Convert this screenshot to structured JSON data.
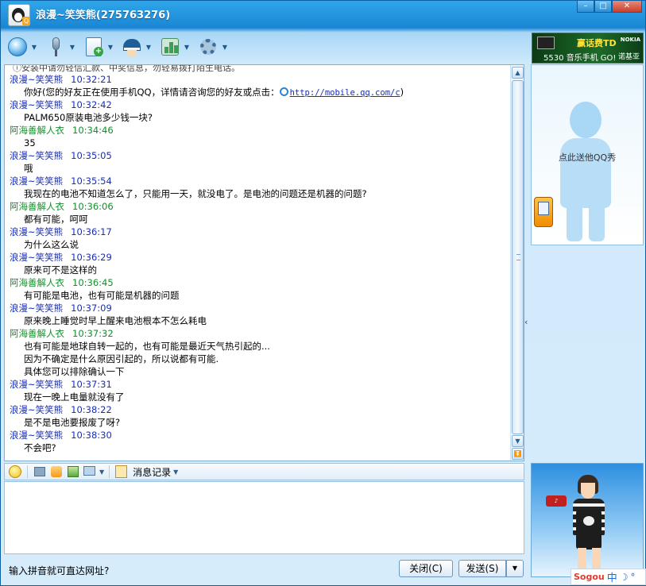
{
  "window": {
    "title": "浪漫~笑笑熊(275763276)",
    "controls": [
      "–",
      "□",
      "✕"
    ]
  },
  "toolbar": {
    "items": [
      {
        "name": "video-chat",
        "icon": "video-sphere-icon"
      },
      {
        "name": "voice-chat",
        "icon": "microphone-icon"
      },
      {
        "name": "send-file",
        "icon": "document-add-icon"
      },
      {
        "name": "friend-info",
        "icon": "police-cap-icon"
      },
      {
        "name": "apps",
        "icon": "app-bars-icon"
      },
      {
        "name": "settings",
        "icon": "gear-icon"
      }
    ]
  },
  "history": {
    "system_line": "ⓘ安装中请勿轻信汇款、中奖信息，勿轻易拨打陌生电话。",
    "messages": [
      {
        "sender": "浪漫~笑笑熊",
        "role": "me",
        "time": "10:32:21",
        "lines": [
          "你好(您的好友正在使用手机QQ，详情请咨询您的好友或点击：)"
        ],
        "link": "http://mobile.qq.com/c"
      },
      {
        "sender": "浪漫~笑笑熊",
        "role": "me",
        "time": "10:32:42",
        "lines": [
          "PALM650原装电池多少钱一块?"
        ]
      },
      {
        "sender": "阿海善解人衣",
        "role": "peer",
        "time": "10:34:46",
        "lines": [
          "35"
        ]
      },
      {
        "sender": "浪漫~笑笑熊",
        "role": "me",
        "time": "10:35:05",
        "lines": [
          "哦"
        ]
      },
      {
        "sender": "浪漫~笑笑熊",
        "role": "me",
        "time": "10:35:54",
        "lines": [
          "我现在的电池不知道怎么了，只能用一天，就没电了。是电池的问题还是机器的问题?"
        ]
      },
      {
        "sender": "阿海善解人衣",
        "role": "peer",
        "time": "10:36:06",
        "lines": [
          "都有可能，呵呵"
        ]
      },
      {
        "sender": "浪漫~笑笑熊",
        "role": "me",
        "time": "10:36:17",
        "lines": [
          "为什么这么说"
        ]
      },
      {
        "sender": "浪漫~笑笑熊",
        "role": "me",
        "time": "10:36:29",
        "lines": [
          "原来可不是这样的"
        ]
      },
      {
        "sender": "阿海善解人衣",
        "role": "peer",
        "time": "10:36:45",
        "lines": [
          "有可能是电池，也有可能是机器的问题"
        ]
      },
      {
        "sender": "浪漫~笑笑熊",
        "role": "me",
        "time": "10:37:09",
        "lines": [
          "原来晚上睡觉时早上醒来电池根本不怎么耗电"
        ]
      },
      {
        "sender": "阿海善解人衣",
        "role": "peer",
        "time": "10:37:32",
        "lines": [
          "也有可能是地球自转一起的，也有可能是最近天气热引起的...",
          "因为不确定是什么原因引起的，所以说都有可能.",
          "具体您可以排除确认一下"
        ]
      },
      {
        "sender": "浪漫~笑笑熊",
        "role": "me",
        "time": "10:37:31",
        "lines": [
          "现在一晚上电量就没有了"
        ]
      },
      {
        "sender": "浪漫~笑笑熊",
        "role": "me",
        "time": "10:38:22",
        "lines": [
          "是不是电池要报废了呀?"
        ]
      },
      {
        "sender": "浪漫~笑笑熊",
        "role": "me",
        "time": "10:38:30",
        "lines": [
          "不会吧?"
        ]
      }
    ]
  },
  "input_toolbar": {
    "message_history_label": "消息记录"
  },
  "input": {
    "value": ""
  },
  "footer": {
    "hint": "输入拼音就可直达网址?",
    "close_label": "关闭(C)",
    "send_label": "发送(S)"
  },
  "ad": {
    "line1": "赢话费TD",
    "brand": "NOKIA",
    "line2": "5530 音乐手机 GO!",
    "brand_cn": "诺基亚"
  },
  "qq_show": {
    "text": "点此送他QQ秀"
  },
  "ime": {
    "logo": "Sogou",
    "mode": "中",
    "moon": "☽",
    "dot": "°"
  },
  "colors": {
    "me_name": "#1a2fb0",
    "peer_name": "#128f2a",
    "title_bar": "#1a86d3"
  }
}
